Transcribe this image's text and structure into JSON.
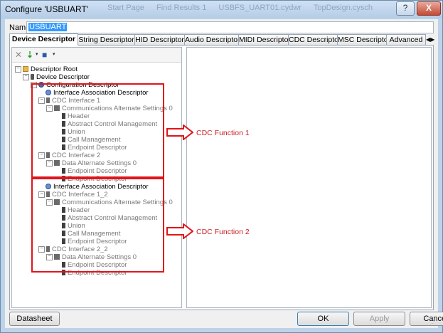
{
  "window": {
    "title": "Configure 'USBUART'"
  },
  "background_titles": [
    "Start Page",
    "Find Results 1",
    "USBFS_UART01.cydwr",
    "TopDesign.cysch"
  ],
  "name_field": {
    "label": "Name:",
    "value": "USBUART"
  },
  "tabs": [
    "Device Descriptor",
    "String Descriptor",
    "HID Descriptor",
    "Audio Descriptor",
    "MIDI Descriptor",
    "CDC Descriptor",
    "MSC Descriptor",
    "Advanced"
  ],
  "tree": [
    "Descriptor Root",
    "Device Descriptor",
    "Configuration Descriptor",
    "Interface Association Descriptor",
    "CDC Interface 1",
    "Communications Alternate Settings 0",
    "Header",
    "Abstract Control Management",
    "Union",
    "Call Management",
    "Endpoint Descriptor",
    "CDC Interface 2",
    "Data Alternate Settings 0",
    "Endpoint Descriptor",
    "Endpoint Descriptor",
    "Interface Association Descriptor",
    "CDC Interface 1_2",
    "Communications Alternate Settings 0",
    "Header",
    "Abstract Control Management",
    "Union",
    "Call Management",
    "Endpoint Descriptor",
    "CDC Interface 2_2",
    "Data Alternate Settings 0",
    "Endpoint Descriptor",
    "Endpoint Descriptor"
  ],
  "annotations": {
    "function1": "CDC Function 1",
    "function2": "CDC Function 2",
    "color": "#e0141b"
  },
  "buttons": {
    "datasheet": "Datasheet",
    "ok": "OK",
    "apply": "Apply",
    "cancel": "Cancel"
  },
  "titlebar_buttons": {
    "help": "?",
    "close": "X"
  },
  "icons": [
    "folder-icon",
    "device-icon",
    "config-icon",
    "iad-icon",
    "interface-icon",
    "alt-setting-icon",
    "leaf-icon",
    "delete-icon",
    "add-icon",
    "save-icon"
  ]
}
